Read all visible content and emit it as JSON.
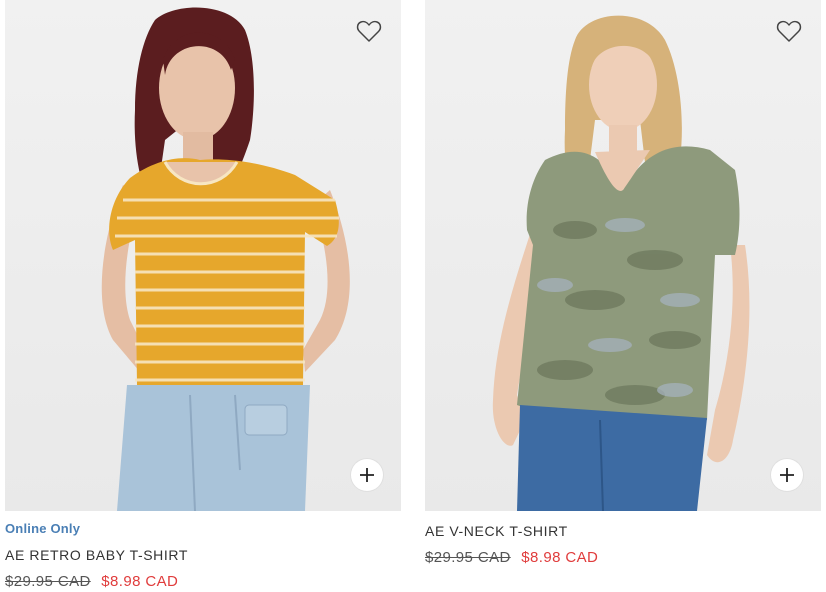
{
  "products": [
    {
      "badge": "Online Only",
      "name": "AE RETRO BABY T-SHIRT",
      "original_price": "$29.95 CAD",
      "sale_price": "$8.98 CAD",
      "image_alt": "Model wearing yellow striped retro baby t-shirt with light wash jeans",
      "favorite_icon": "heart-outline-icon",
      "add_icon": "plus-icon"
    },
    {
      "badge": "",
      "name": "AE V-NECK T-SHIRT",
      "original_price": "$29.95 CAD",
      "sale_price": "$8.98 CAD",
      "image_alt": "Model wearing camo print v-neck t-shirt with blue jeans",
      "favorite_icon": "heart-outline-icon",
      "add_icon": "plus-icon"
    }
  ],
  "colors": {
    "badge": "#4a7fb5",
    "sale_price": "#e03c3c",
    "image_background": "#eeeeee"
  }
}
